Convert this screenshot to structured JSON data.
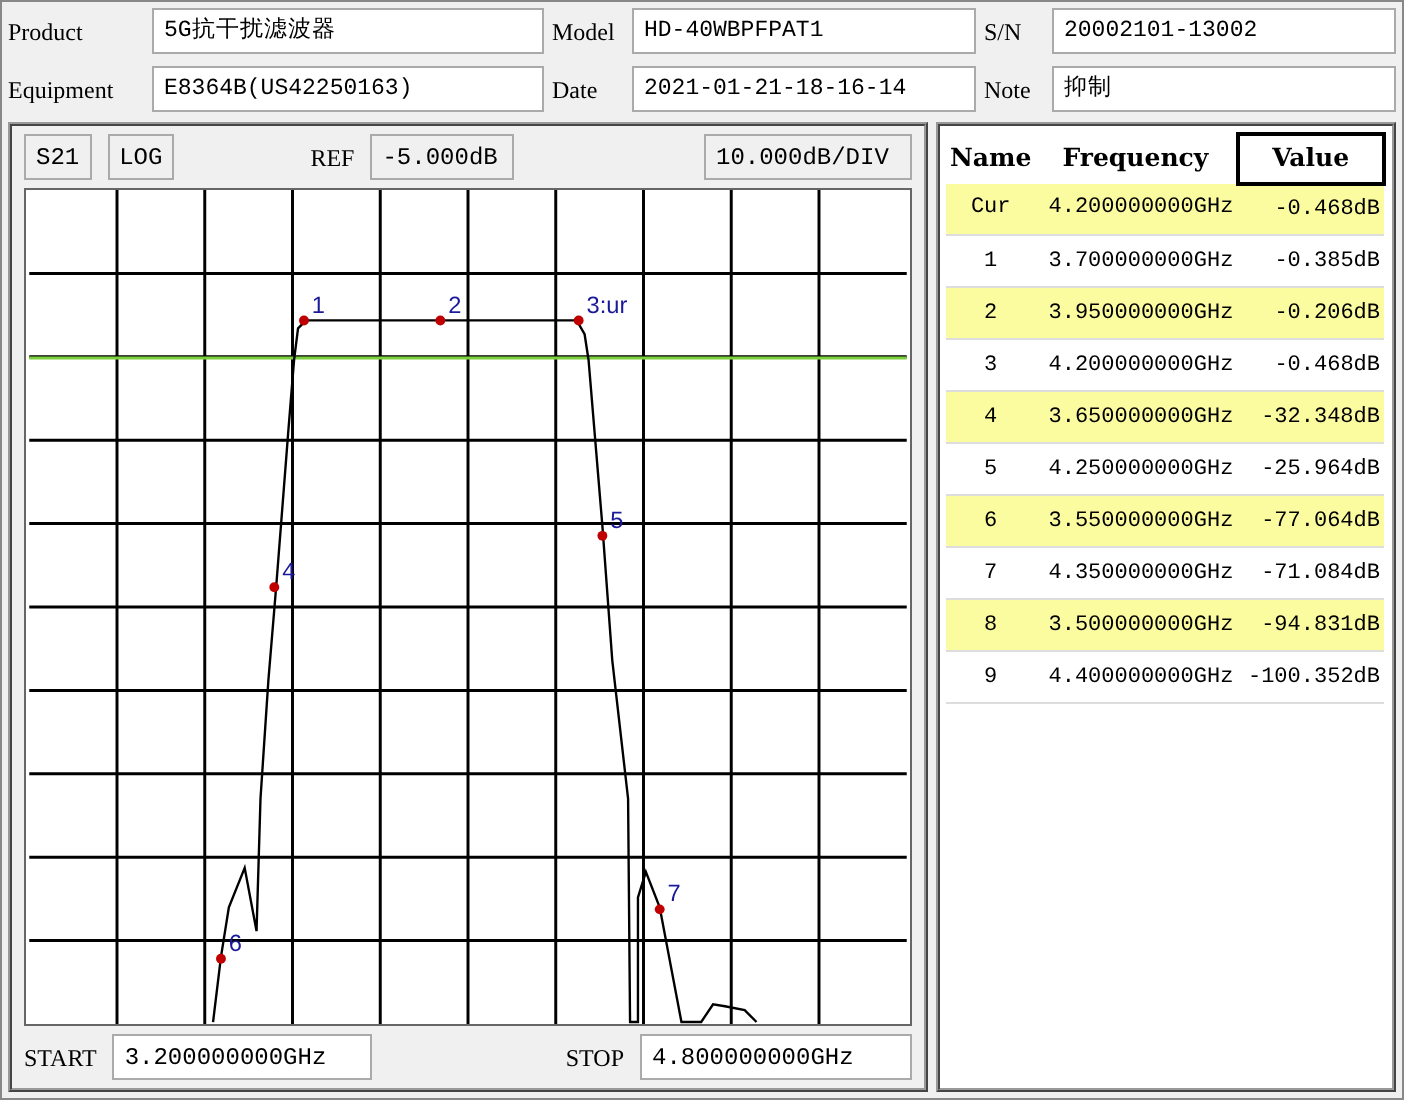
{
  "header": {
    "fields": [
      {
        "label": "Product",
        "value": "5G抗干扰滤波器"
      },
      {
        "label": "Model",
        "value": "HD-40WBPFPAT1"
      },
      {
        "label": "S/N",
        "value": "20002101-13002"
      },
      {
        "label": "Equipment",
        "value": "E8364B(US42250163)"
      },
      {
        "label": "Date",
        "value": "2021-01-21-18-16-14"
      },
      {
        "label": "Note",
        "value": "抑制"
      }
    ]
  },
  "trace_panel": {
    "parameter": "S21",
    "format": "LOG",
    "ref_label": "REF",
    "ref_value": "-5.000dB",
    "scale": "10.000dB/DIV",
    "marker_labels": [
      "1",
      "2",
      "3:ur",
      "4",
      "5",
      "6",
      "7"
    ],
    "start_label": "START",
    "start_value": "3.200000000GHz",
    "stop_label": "STOP",
    "stop_value": "4.800000000GHz"
  },
  "marker_table": {
    "columns": [
      {
        "label": "Name",
        "selected": false
      },
      {
        "label": "Frequency",
        "selected": false
      },
      {
        "label": "Value",
        "selected": true
      }
    ],
    "rows": [
      {
        "name": "Cur",
        "frequency": "4.200000000GHz",
        "value": "-0.468dB"
      },
      {
        "name": "1",
        "frequency": "3.700000000GHz",
        "value": "-0.385dB"
      },
      {
        "name": "2",
        "frequency": "3.950000000GHz",
        "value": "-0.206dB"
      },
      {
        "name": "3",
        "frequency": "4.200000000GHz",
        "value": "-0.468dB"
      },
      {
        "name": "4",
        "frequency": "3.650000000GHz",
        "value": "-32.348dB"
      },
      {
        "name": "5",
        "frequency": "4.250000000GHz",
        "value": "-25.964dB"
      },
      {
        "name": "6",
        "frequency": "3.550000000GHz",
        "value": "-77.064dB"
      },
      {
        "name": "7",
        "frequency": "4.350000000GHz",
        "value": "-71.084dB"
      },
      {
        "name": "8",
        "frequency": "3.500000000GHz",
        "value": "-94.831dB"
      },
      {
        "name": "9",
        "frequency": "4.400000000GHz",
        "value": "-100.352dB"
      }
    ]
  }
}
